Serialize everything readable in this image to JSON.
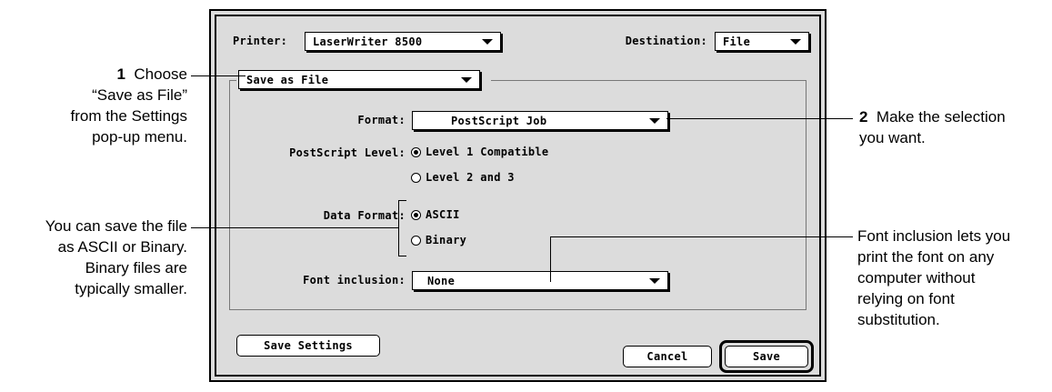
{
  "dialog": {
    "printer_label": "Printer:",
    "printer_value": "LaserWriter 8500",
    "destination_label": "Destination:",
    "destination_value": "File",
    "settings_menu_value": "Save as File",
    "format_label": "Format:",
    "format_value": "PostScript Job",
    "postscript_level_label": "PostScript Level:",
    "postscript_level_options": [
      "Level 1 Compatible",
      "Level 2 and 3"
    ],
    "postscript_level_selected": "Level 1 Compatible",
    "data_format_label": "Data Format:",
    "data_format_options": [
      "ASCII",
      "Binary"
    ],
    "data_format_selected": "ASCII",
    "font_inclusion_label": "Font inclusion:",
    "font_inclusion_value": "None",
    "save_settings_label": "Save Settings",
    "cancel_label": "Cancel",
    "save_label": "Save"
  },
  "callouts": {
    "step1_num": "1",
    "step1_lines": [
      "Choose",
      "“Save as File”",
      "from the Settings",
      "pop-up menu."
    ],
    "step2_num": "2",
    "step2_lines": [
      "Make the selection",
      "you want."
    ],
    "ascii_binary_lines": [
      "You can save the file",
      "as ASCII or Binary.",
      "Binary files are",
      "typically smaller."
    ],
    "font_inclusion_lines": [
      "Font inclusion lets you",
      "print the font on any",
      "computer without",
      "relying on font",
      "substitution."
    ]
  }
}
